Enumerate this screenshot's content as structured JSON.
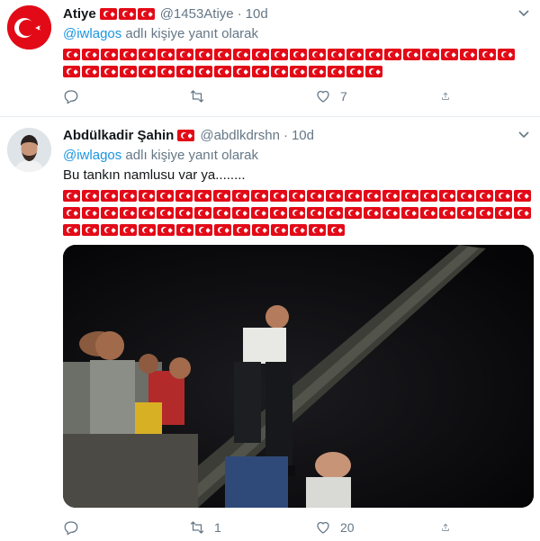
{
  "tweets": [
    {
      "name": "Atiye",
      "handle": "@1453Atiye",
      "time": "10d",
      "reply_to": "@iwlagos",
      "reply_suffix": " adlı kişiye yanıt olarak",
      "body": "",
      "name_flag_count": 3,
      "flag_rows": [
        24,
        17
      ],
      "stats": {
        "replies": "",
        "retweets": "",
        "likes": "7"
      },
      "icons": {
        "avatar": "turkish-flag-avatar",
        "menu": "chevron-down-icon"
      }
    },
    {
      "name": "Abdülkadir Şahin",
      "handle": "@abdlkdrshn",
      "time": "10d",
      "reply_to": "@iwlagos",
      "reply_suffix": " adlı kişiye yanıt olarak",
      "body": "Bu tankın namlusu var ya........",
      "name_flag_count": 1,
      "flag_rows": [
        25,
        25,
        15
      ],
      "stats": {
        "replies": "",
        "retweets": "1",
        "likes": "20"
      },
      "icons": {
        "avatar": "profile-photo-avatar",
        "menu": "chevron-down-icon"
      }
    }
  ],
  "colors": {
    "flag_red": "#e30a17",
    "link_blue": "#1b95e0",
    "muted": "#657786"
  }
}
